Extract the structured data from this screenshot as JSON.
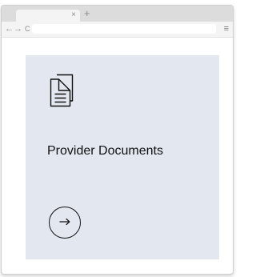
{
  "browser": {
    "tab_close_glyph": "×",
    "new_tab_glyph": "+",
    "back_glyph": "←",
    "forward_glyph": "→",
    "reload_glyph": "C",
    "menu_glyph": "≡"
  },
  "card": {
    "icon": "documents-icon",
    "title": "Provider Documents",
    "action_icon": "arrow-right-icon"
  },
  "colors": {
    "card_background": "#e2e7f0",
    "text": "#111111"
  }
}
